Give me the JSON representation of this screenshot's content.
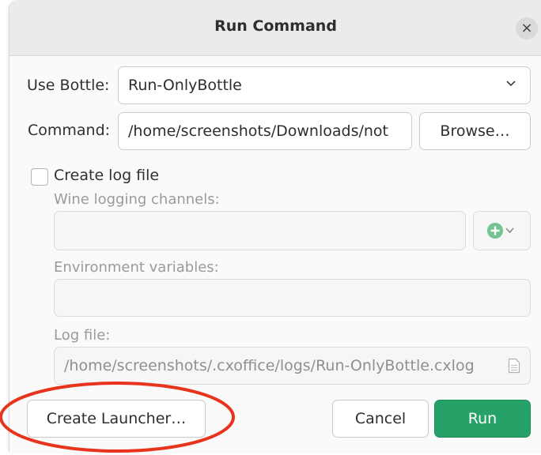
{
  "dialog": {
    "title": "Run Command"
  },
  "form": {
    "bottle_label": "Use Bottle:",
    "bottle_value": "Run-OnlyBottle",
    "command_label": "Command:",
    "command_value": "/home/screenshots/Downloads/not",
    "browse_label": "Browse…",
    "log_checkbox_label": "Create log file",
    "log_checkbox_checked": false,
    "wine_channels_label": "Wine logging channels:",
    "wine_channels_value": "",
    "env_vars_label": "Environment variables:",
    "env_vars_value": "",
    "log_file_label": "Log file:",
    "log_file_value": "/home/screenshots/.cxoffice/logs/Run-OnlyBottle.cxlog"
  },
  "buttons": {
    "create_launcher": "Create Launcher…",
    "cancel": "Cancel",
    "run": "Run"
  },
  "colors": {
    "run_button": "#26a269",
    "add_channel_icon": "#73c48f",
    "annotation": "#e8341c"
  },
  "icons": {
    "close": "close-icon",
    "dropdown": "chevron-down-icon",
    "add_channel": "plus-circle-icon",
    "log_file": "document-icon"
  }
}
